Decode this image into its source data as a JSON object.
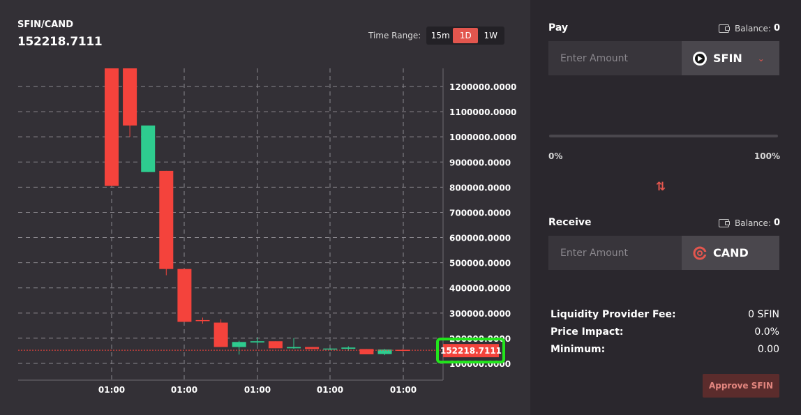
{
  "chart_header": {
    "pair": "SFIN/CAND",
    "price": "152218.7111"
  },
  "time_range": {
    "label": "Time Range:",
    "options": [
      "15m",
      "1D",
      "1W"
    ],
    "selected": "1D"
  },
  "colors": {
    "up": "#2ecc8f",
    "down": "#f4433c",
    "accent": "#e3564e",
    "price_highlight": "#22e51c"
  },
  "chart_data": {
    "type": "candlestick",
    "y_axis_ticks": [
      "1200000.0000",
      "1100000.0000",
      "1000000.0000",
      "900000.0000",
      "800000.0000",
      "700000.0000",
      "600000.0000",
      "500000.0000",
      "400000.0000",
      "300000.0000",
      "200000.0000",
      "100000.0000"
    ],
    "x_axis_ticks": [
      "01:00",
      "01:00",
      "01:00",
      "01:00",
      "01:00"
    ],
    "ylim": [
      50000,
      1300000
    ],
    "last_price_label": "152218.7111",
    "candles": [
      {
        "o": 1295000,
        "h": 1295000,
        "l": 805000,
        "c": 805000
      },
      {
        "o": 1295000,
        "h": 1295000,
        "l": 1000000,
        "c": 1045000
      },
      {
        "o": 860000,
        "h": 1045000,
        "l": 860000,
        "c": 1045000
      },
      {
        "o": 865000,
        "h": 865000,
        "l": 450000,
        "c": 475000
      },
      {
        "o": 475000,
        "h": 475000,
        "l": 265000,
        "c": 265000
      },
      {
        "o": 272000,
        "h": 282000,
        "l": 258000,
        "c": 270000
      },
      {
        "o": 262000,
        "h": 275000,
        "l": 165000,
        "c": 165000
      },
      {
        "o": 165000,
        "h": 190000,
        "l": 135000,
        "c": 185000
      },
      {
        "o": 183000,
        "h": 202000,
        "l": 172000,
        "c": 188000
      },
      {
        "o": 188000,
        "h": 188000,
        "l": 160000,
        "c": 160000
      },
      {
        "o": 160000,
        "h": 200000,
        "l": 158000,
        "c": 165000
      },
      {
        "o": 165000,
        "h": 165000,
        "l": 157000,
        "c": 157000
      },
      {
        "o": 157000,
        "h": 160000,
        "l": 152000,
        "c": 159000
      },
      {
        "o": 158000,
        "h": 168000,
        "l": 150000,
        "c": 163000
      },
      {
        "o": 157000,
        "h": 157000,
        "l": 136000,
        "c": 136000
      },
      {
        "o": 137000,
        "h": 157000,
        "l": 133000,
        "c": 155000
      },
      {
        "o": 154000,
        "h": 158000,
        "l": 146000,
        "c": 152000
      }
    ]
  },
  "pay": {
    "label": "Pay",
    "balance_label": "Balance:",
    "balance_value": "0",
    "placeholder": "Enter Amount",
    "token": "SFIN"
  },
  "slider": {
    "min_label": "0%",
    "max_label": "100%",
    "value": 0
  },
  "receive": {
    "label": "Receive",
    "balance_label": "Balance:",
    "balance_value": "0",
    "placeholder": "Enter Amount",
    "token": "CAND"
  },
  "info": [
    {
      "key": "Liquidity Provider Fee:",
      "value": "0 SFIN"
    },
    {
      "key": "Price Impact:",
      "value": "0.0%"
    },
    {
      "key": "Minimum:",
      "value": "0.00"
    }
  ],
  "approve_button": "Approve SFIN"
}
